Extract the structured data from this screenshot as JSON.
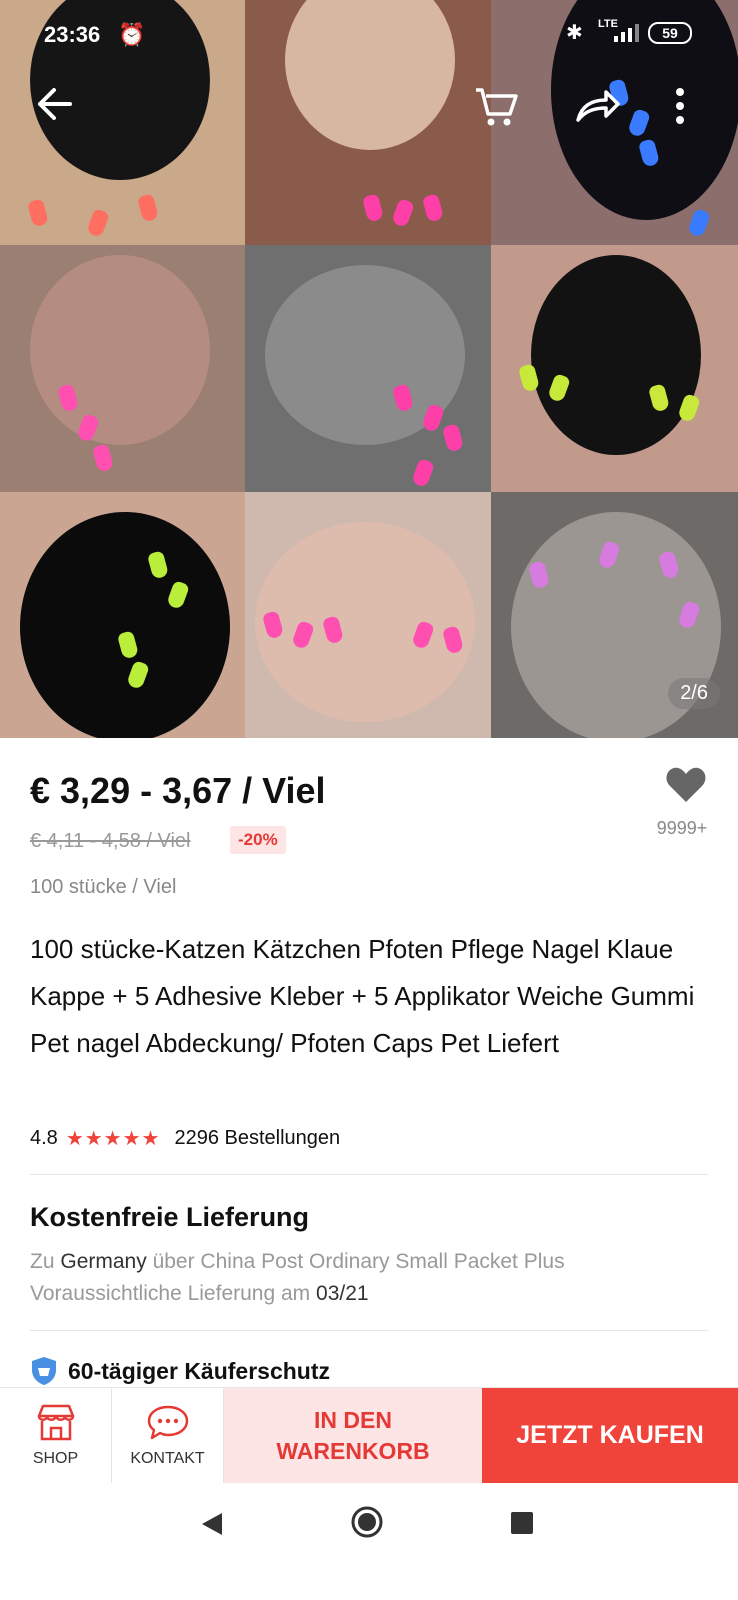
{
  "status_bar": {
    "time": "23:36",
    "lte": "LTE",
    "battery": "59"
  },
  "gallery": {
    "counter": "2/6",
    "tiles": [
      {
        "bg": "#caa98a",
        "cat": "#151515",
        "claw": "#ff6f61"
      },
      {
        "bg": "#8a5a4a",
        "cat": "#d8b7a0",
        "claw": "#ff3fa8"
      },
      {
        "bg": "#8c6f6c",
        "cat": "#0e0e14",
        "claw": "#3a7bff"
      },
      {
        "bg": "#9a7f72",
        "cat": "#b58c82",
        "claw": "#ff4fb1"
      },
      {
        "bg": "#6f6f6f",
        "cat": "#8b8b8b",
        "claw": "#ff3fa8"
      },
      {
        "bg": "#c29a8c",
        "cat": "#121212",
        "claw": "#c8e83a"
      },
      {
        "bg": "#c9a592",
        "cat": "#0b0b0b",
        "claw": "#b9ef3b"
      },
      {
        "bg": "#cfb9ae",
        "cat": "#ddbcae",
        "claw": "#ff4fb1"
      },
      {
        "bg": "#6d6a68",
        "cat": "#9b9692",
        "claw": "#d77be0"
      }
    ]
  },
  "product": {
    "price": "€ 3,29 - 3,67 / Viel",
    "old_price": "€ 4,11 - 4,58 / Viel",
    "discount": "-20%",
    "lot": "100 stücke / Viel",
    "likes": "9999+",
    "title": "100 stücke-Katzen Kätzchen Pfoten Pflege Nagel Klaue Kappe + 5 Adhesive Kleber + 5 Applikator Weiche Gummi Pet nagel Abdeckung/ Pfoten Caps Pet Liefert",
    "rating": "4.8",
    "stars": "★★★★★",
    "orders": "2296 Bestellungen"
  },
  "shipping": {
    "title": "Kostenfreie Lieferung",
    "to_prefix": "Zu",
    "country": "Germany",
    "via": "über China Post Ordinary Small Packet Plus",
    "eta_prefix": "Voraussichtliche Lieferung am",
    "eta_date": "03/21"
  },
  "protection": {
    "label": "60-tägiger Käuferschutz"
  },
  "actions": {
    "shop": "SHOP",
    "contact": "KONTAKT",
    "add_to_cart": "IN DEN WARENKORB",
    "buy_now": "JETZT KAUFEN"
  },
  "colors": {
    "accent": "#f0433a",
    "accent_light": "#fde5e5",
    "shield": "#4a90e2"
  }
}
